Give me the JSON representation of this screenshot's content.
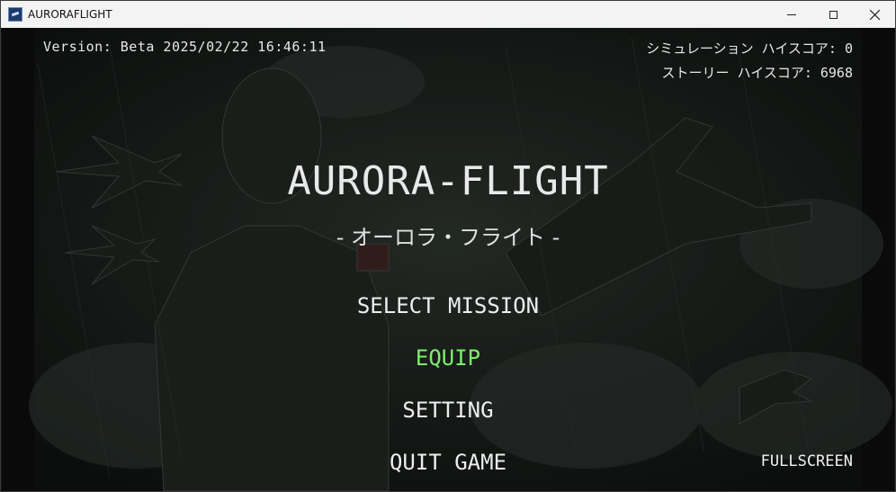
{
  "window": {
    "title": "AURORAFLIGHT"
  },
  "hud": {
    "version": "Version: Beta 2025/02/22 16:46:11",
    "simulation_highscore": "シミュレーション ハイスコア: 0",
    "story_highscore": "ストーリー ハイスコア: 6968"
  },
  "game": {
    "title": "AURORA-FLIGHT",
    "subtitle": "- オーロラ・フライト -"
  },
  "menu": {
    "items": [
      {
        "label": "SELECT MISSION"
      },
      {
        "label": "EQUIP"
      },
      {
        "label": "SETTING"
      },
      {
        "label": "QUIT GAME"
      }
    ],
    "selected": "EQUIP"
  },
  "fullscreen_label": "FULLSCREEN",
  "colors": {
    "selected": "#7cf16c",
    "text": "#eeeeee",
    "background": "#121614"
  }
}
